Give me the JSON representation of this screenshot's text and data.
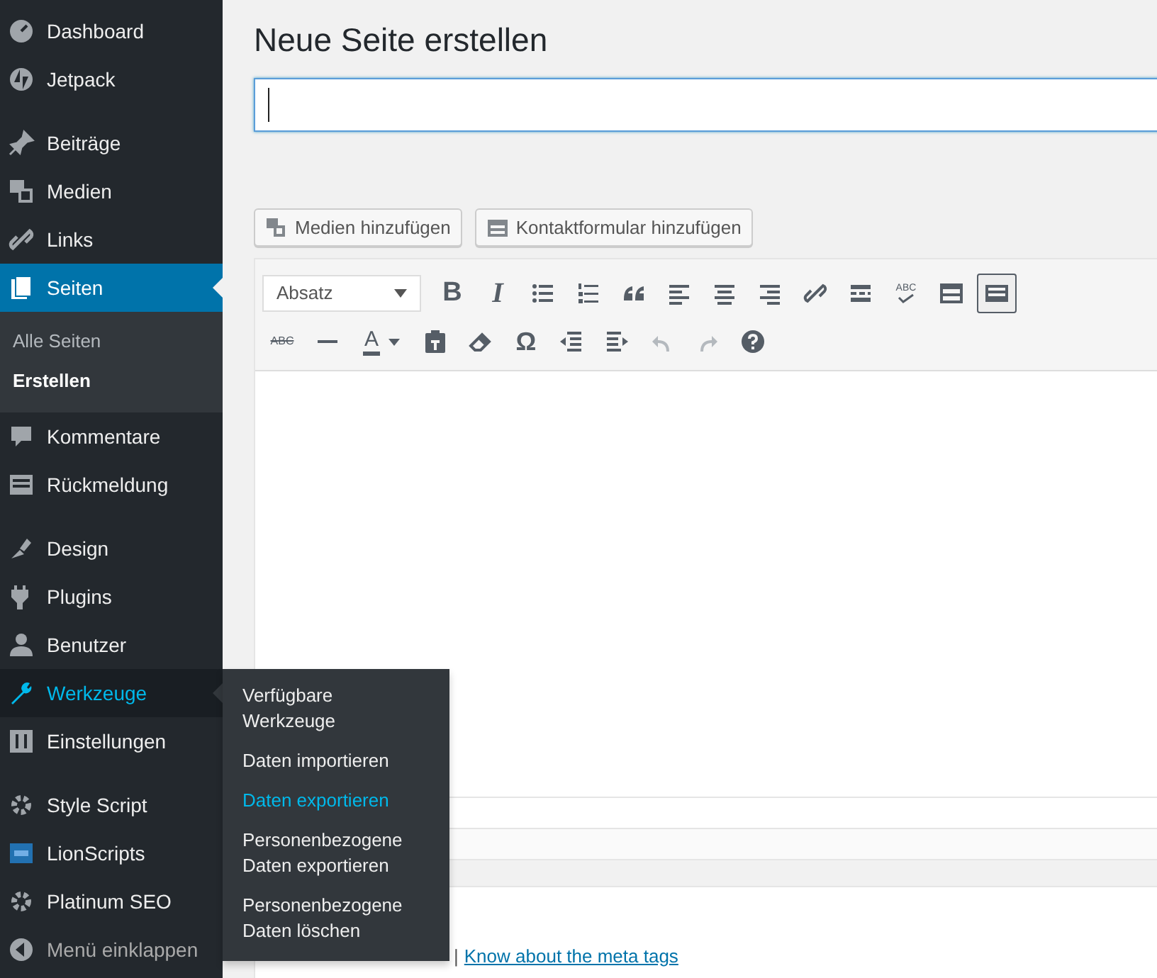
{
  "sidebar": {
    "groups": [
      [
        {
          "label": "Dashboard",
          "kind": "item",
          "selected": false,
          "hovered": false
        },
        {
          "label": "Jetpack",
          "kind": "item",
          "selected": false,
          "hovered": false
        }
      ],
      [
        {
          "label": "Beiträge",
          "kind": "item",
          "selected": false,
          "hovered": false
        },
        {
          "label": "Medien",
          "kind": "item",
          "selected": false,
          "hovered": false
        },
        {
          "label": "Links",
          "kind": "item",
          "selected": false,
          "hovered": false
        },
        {
          "label": "Seiten",
          "kind": "item",
          "selected": true,
          "hovered": false,
          "children": [
            {
              "label": "Alle Seiten",
              "selected": false
            },
            {
              "label": "Erstellen",
              "selected": true
            }
          ]
        },
        {
          "label": "Kommentare",
          "kind": "item",
          "selected": false,
          "hovered": false
        },
        {
          "label": "Rückmeldung",
          "kind": "item",
          "selected": false,
          "hovered": false
        }
      ],
      [
        {
          "label": "Design",
          "kind": "item",
          "selected": false,
          "hovered": false
        },
        {
          "label": "Plugins",
          "kind": "item",
          "selected": false,
          "hovered": false
        },
        {
          "label": "Benutzer",
          "kind": "item",
          "selected": false,
          "hovered": false
        },
        {
          "label": "Werkzeuge",
          "kind": "item",
          "selected": false,
          "hovered": true,
          "flyout": [
            {
              "label": "Verfügbare Werkzeuge",
              "selected": false
            },
            {
              "label": "Daten importieren",
              "selected": false
            },
            {
              "label": "Daten exportieren",
              "selected": true
            },
            {
              "label": "Personenbezogene Daten exportieren",
              "selected": false
            },
            {
              "label": "Personenbezogene Daten löschen",
              "selected": false
            }
          ]
        },
        {
          "label": "Einstellungen",
          "kind": "item",
          "selected": false,
          "hovered": false
        }
      ],
      [
        {
          "label": "Style Script",
          "kind": "item",
          "selected": false,
          "hovered": false
        },
        {
          "label": "LionScripts",
          "kind": "item",
          "selected": false,
          "hovered": false
        },
        {
          "label": "Platinum SEO",
          "kind": "item",
          "selected": false,
          "hovered": false
        },
        {
          "label": "Menü einklappen",
          "kind": "collapse",
          "selected": false,
          "hovered": false
        }
      ]
    ]
  },
  "page": {
    "title": "Neue Seite erstellen",
    "media_buttons": [
      "Medien hinzufügen",
      "Kontaktformular hinzufügen"
    ],
    "format_select": {
      "value": "Absatz"
    },
    "toolbar_rows": [
      [
        {
          "kind": "bold",
          "text": "B"
        },
        {
          "kind": "italic",
          "text": "I"
        },
        {
          "kind": "bullets"
        },
        {
          "kind": "numbers"
        },
        {
          "kind": "quote"
        },
        {
          "kind": "alignleft"
        },
        {
          "kind": "aligncenter"
        },
        {
          "kind": "alignright"
        },
        {
          "kind": "link"
        },
        {
          "kind": "more"
        },
        {
          "kind": "spellcheck",
          "text": "ABC"
        },
        {
          "kind": "form"
        },
        {
          "kind": "toggle",
          "pressed": true
        }
      ],
      [
        {
          "kind": "strike",
          "text": "ABC"
        },
        {
          "kind": "hr"
        },
        {
          "kind": "color",
          "text": "A"
        },
        {
          "kind": "paste"
        },
        {
          "kind": "eraser"
        },
        {
          "kind": "symbol",
          "text": "Ω"
        },
        {
          "kind": "outdent"
        },
        {
          "kind": "indent"
        },
        {
          "kind": "undo",
          "disabled": true
        },
        {
          "kind": "redo",
          "disabled": true
        },
        {
          "kind": "help"
        }
      ]
    ],
    "footer": {
      "separator": "|",
      "link": "Know about the meta tags"
    }
  }
}
